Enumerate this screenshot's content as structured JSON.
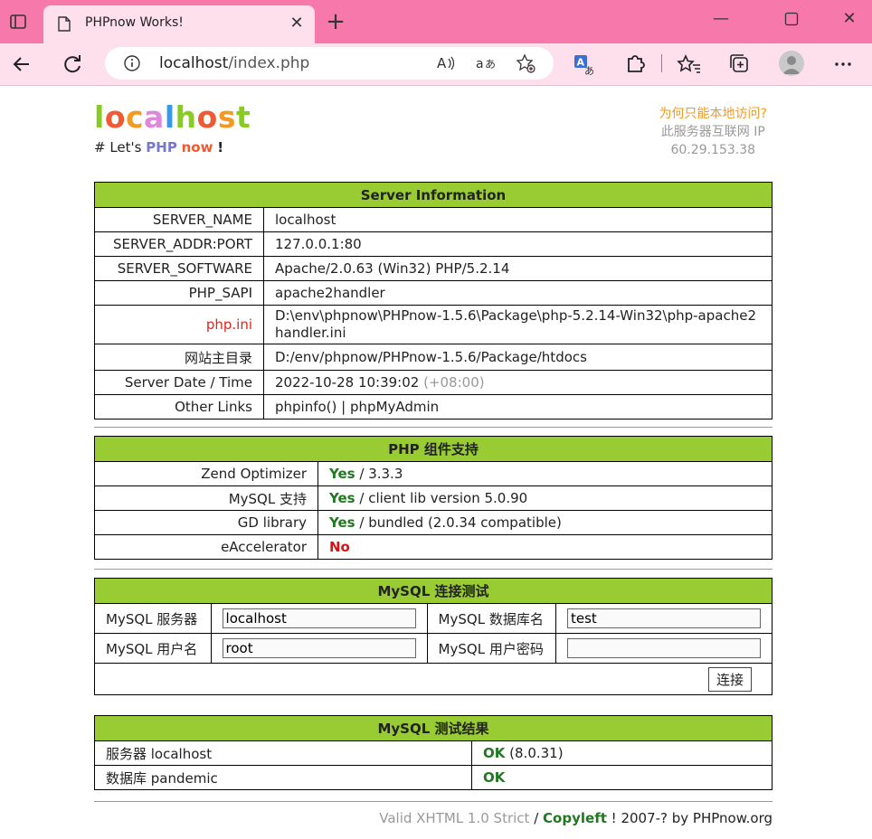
{
  "browser": {
    "tab_title": "PHPnow Works!",
    "url_host": "localhost",
    "url_path": "/index.php",
    "icons": [
      "tab-actions-icon",
      "page-icon",
      "close-icon",
      "plus-icon",
      "minimize-icon",
      "maximize-icon",
      "window-close-icon",
      "back-icon",
      "refresh-icon",
      "info-icon",
      "read-aloud-icon",
      "translate-icon",
      "favorite-add-icon",
      "translator-icon",
      "extensions-icon",
      "favorites-icon",
      "collections-icon",
      "profile-icon",
      "more-icon"
    ]
  },
  "header": {
    "logo": [
      "l",
      "o",
      "c",
      "a",
      "l",
      "h",
      "o",
      "s",
      "t"
    ],
    "logo_colors": [
      "#88cc22",
      "#ef5a33",
      "#f29a22",
      "#dd88dd",
      "#3399ee",
      "#88cc22",
      "#ef5a33",
      "#f29a22",
      "#88cc22"
    ],
    "tagline_prefix": "# Let's",
    "tagline_php": "PHP",
    "tagline_now": "now",
    "tagline_bang": "!",
    "why_local": "为何只能本地访问?",
    "internet_ip_label": "此服务器互联网 IP",
    "internet_ip": "60.29.153.38"
  },
  "server_info": {
    "title": "Server Information",
    "rows": [
      {
        "key": "SERVER_NAME",
        "value": "localhost"
      },
      {
        "key": "SERVER_ADDR:PORT",
        "value": "127.0.0.1:80"
      },
      {
        "key": "SERVER_SOFTWARE",
        "value": "Apache/2.0.63 (Win32) PHP/5.2.14"
      },
      {
        "key": "PHP_SAPI",
        "value": "apache2handler"
      },
      {
        "key": "php.ini",
        "value": "D:\\env\\phpnow\\PHPnow-1.5.6\\Package\\php-5.2.14-Win32\\php-apache2handler.ini"
      },
      {
        "key": "网站主目录",
        "value": "D:/env/phpnow/PHPnow-1.5.6/Package/htdocs"
      },
      {
        "key": "Server Date / Time",
        "value": "2022-10-28 10:39:02",
        "extra": "(+08:00)"
      },
      {
        "key": "Other Links",
        "value_a": "phpinfo()",
        "value_sep": "|",
        "value_b": "phpMyAdmin"
      }
    ]
  },
  "php_components": {
    "title": "PHP 组件支持",
    "rows": [
      {
        "key": "Zend Optimizer",
        "status": "Yes",
        "detail": "/ 3.3.3"
      },
      {
        "key": "MySQL 支持",
        "status": "Yes",
        "detail": "/ client lib version 5.0.90"
      },
      {
        "key": "GD library",
        "status": "Yes",
        "detail": "/ bundled (2.0.34 compatible)"
      },
      {
        "key": "eAccelerator",
        "status": "No",
        "detail": ""
      }
    ]
  },
  "mysql_test": {
    "title": "MySQL 连接测试",
    "server_label": "MySQL 服务器",
    "server_value": "localhost",
    "db_label": "MySQL 数据库名",
    "db_value": "test",
    "user_label": "MySQL 用户名",
    "user_value": "root",
    "pass_label": "MySQL 用户密码",
    "pass_value": "",
    "connect_button": "连接"
  },
  "mysql_result": {
    "title": "MySQL 测试结果",
    "row1_key": "服务器 localhost",
    "row1_status": "OK",
    "row1_detail": "(8.0.31)",
    "row2_key": "数据库 pandemic",
    "row2_status": "OK"
  },
  "footer": {
    "valid": "Valid XHTML 1.0 Strict",
    "slash": "/",
    "copyleft": "Copyleft",
    "rest": "! 2007-? by PHPnow.org"
  }
}
